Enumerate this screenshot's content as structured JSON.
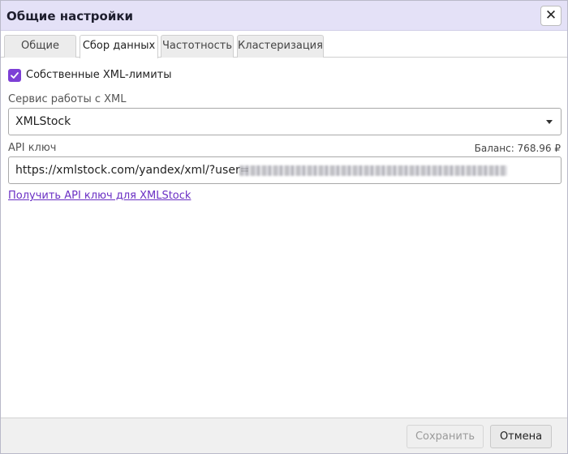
{
  "window": {
    "title": "Общие настройки",
    "close_label": "✕"
  },
  "tabs": [
    {
      "label": "Общие",
      "active": false
    },
    {
      "label": "Сбор данных",
      "active": true
    },
    {
      "label": "Частотность",
      "active": false
    },
    {
      "label": "Кластеризация",
      "active": false
    }
  ],
  "own_limits": {
    "label": "Собственные XML-лимиты",
    "checked": true
  },
  "service": {
    "label": "Сервис работы с XML",
    "value": "XMLStock"
  },
  "api_key": {
    "label": "API ключ",
    "balance": "Баланс: 768.96 ₽",
    "value_visible": "https://xmlstock.com/yandex/xml/?user="
  },
  "get_key_link": "Получить API ключ для XMLStock",
  "footer": {
    "save_label": "Сохранить",
    "cancel_label": "Отмена"
  },
  "colors": {
    "accent": "#7d3fd6",
    "titlebar": "#e4e1f7",
    "link": "#6a2fc4"
  }
}
